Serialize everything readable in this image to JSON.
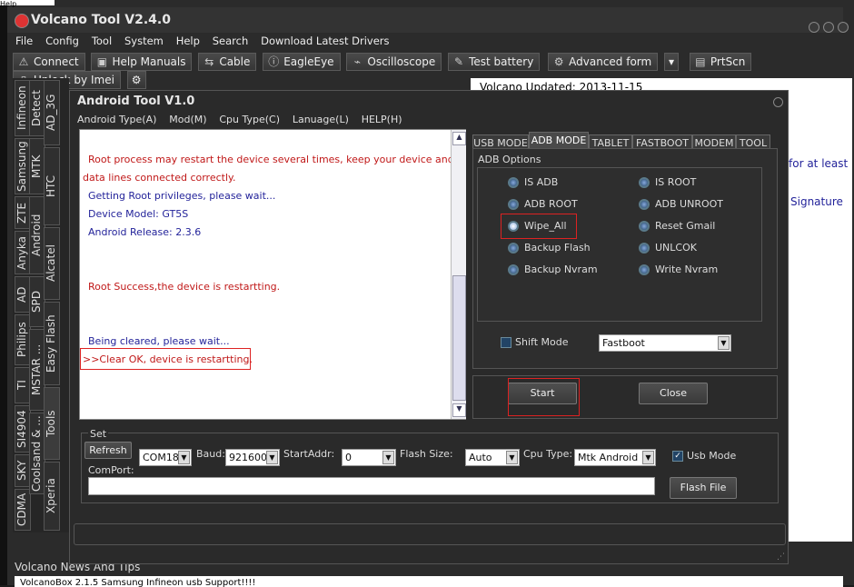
{
  "app": {
    "title": "Volcano Tool V2.4.0",
    "help_fragment": "Help"
  },
  "menu": [
    "File",
    "Config",
    "Tool",
    "System",
    "Help",
    "Search",
    "Download Latest Drivers"
  ],
  "toolbar": [
    "Connect",
    "Help Manuals",
    "Cable",
    "EagleEye",
    "Oscilloscope",
    "Test battery",
    "Advanced form",
    "PrtScn",
    "Unlock by Imei"
  ],
  "left_tabs_col1": [
    "Infineon",
    "Samsung",
    "ZTE",
    "Anyka",
    "AD",
    "Philips",
    "TI",
    "SI4904",
    "SKY",
    "CDMA"
  ],
  "left_tabs_col2": [
    "Detect",
    "MTK",
    "Android",
    "SPD",
    "MSTAR ...",
    "Coolsand & ...",
    "Xperia"
  ],
  "left_tabs_col3": [
    "AD_3G",
    "HTC",
    "Alcatel",
    "Easy Flash",
    "Tools"
  ],
  "right_panel": {
    "updated": "Volcano Updated: 2013-11-15",
    "frag1": "for at least",
    "frag2": "Signature"
  },
  "news": {
    "title": "Volcano News And Tips",
    "item": "VolcanoBox 2.1.5 Samsung Infineon usb Support!!!!"
  },
  "dialog": {
    "title": "Android Tool V1.0",
    "menu": [
      "Android Type(A)",
      "Mod(M)",
      "Cpu Type(C)",
      "Lanuage(L)",
      "HELP(H)"
    ],
    "log": [
      {
        "text": "Root process may restart the device several times, keep your device and",
        "color": "red"
      },
      {
        "text": "data lines connected correctly.",
        "color": "red"
      },
      {
        "text": "Getting Root privileges, please wait...",
        "color": "blue"
      },
      {
        "text": "Device Model: GT5S",
        "color": "blue"
      },
      {
        "text": "Android Release: 2.3.6",
        "color": "blue"
      },
      {
        "text": "Root Success,the device is restartting.",
        "color": "red"
      },
      {
        "text": "Being cleared, please wait...",
        "color": "blue"
      },
      {
        "text": ">>Clear OK, device is restartting.",
        "color": "red"
      }
    ],
    "tabs": [
      "USB MODE",
      "ADB MODE",
      "TABLET",
      "FASTBOOT",
      "MODEM",
      "TOOL"
    ],
    "active_tab": "ADB MODE",
    "adb_title": "ADB Options",
    "adb_left": [
      "IS ADB",
      "ADB ROOT",
      "Wipe_All",
      "Backup Flash",
      "Backup Nvram"
    ],
    "adb_right": [
      "IS ROOT",
      "ADB UNROOT",
      "Reset Gmail",
      "UNLCOK",
      "Write Nvram"
    ],
    "shift_mode": "Shift Mode",
    "shift_value": "Fastboot",
    "start": "Start",
    "close": "Close",
    "set": {
      "title": "Set",
      "refresh": "Refresh",
      "com": "COM18",
      "baud_label": "Baud:",
      "baud": "921600",
      "start_label": "StartAddr:",
      "start_value": "0",
      "flash_label": "Flash Size:",
      "flash_value": "Auto",
      "cpu_label": "Cpu Type:",
      "cpu_value": "Mtk Android",
      "usb_mode": "Usb Mode",
      "comport": "ComPort:",
      "flash_file": "Flash File"
    }
  }
}
